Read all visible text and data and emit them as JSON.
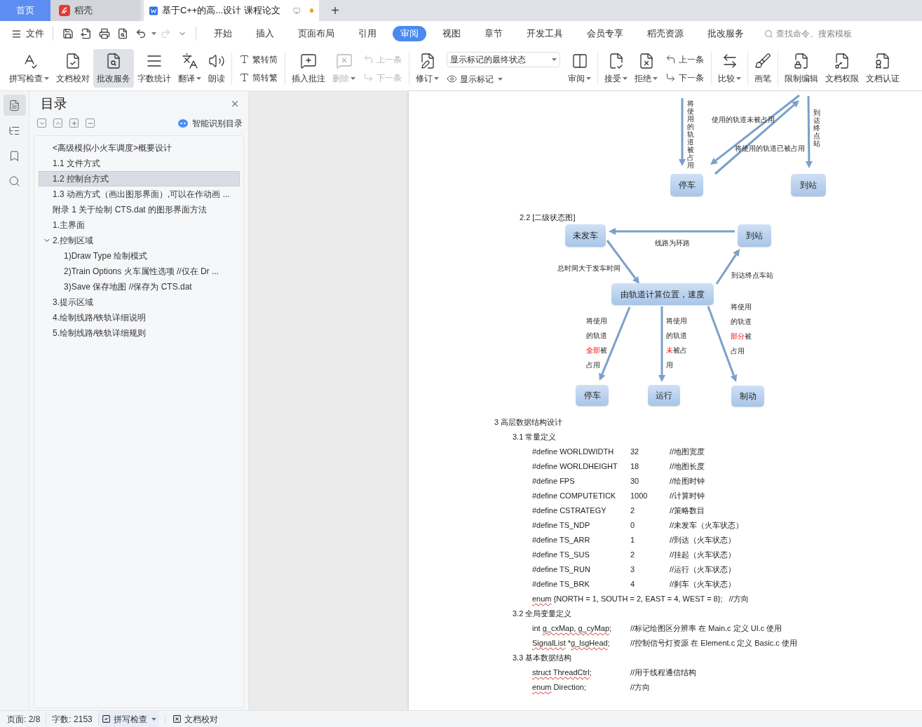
{
  "tabs": [
    {
      "kind": "home",
      "label": "首页",
      "selected": false
    },
    {
      "kind": "app",
      "label": "稻壳",
      "selected": false
    },
    {
      "kind": "doc",
      "label": "基于C++的高...设计 课程论文",
      "selected": true,
      "unsaved": true
    }
  ],
  "new_tab": "+",
  "menu": {
    "file": "文件",
    "quick_access": [
      {
        "disabled": false
      },
      {
        "disabled": false
      },
      {
        "disabled": false
      },
      {
        "disabled": false
      },
      {
        "disabled": false
      },
      {
        "disabled": true
      },
      {
        "disabled": false
      }
    ],
    "tabs": [
      {
        "label": "开始",
        "selected": false
      },
      {
        "label": "插入",
        "selected": false
      },
      {
        "label": "页面布局",
        "selected": false
      },
      {
        "label": "引用",
        "selected": false
      },
      {
        "label": "审阅",
        "selected": true
      },
      {
        "label": "视图",
        "selected": false
      },
      {
        "label": "章节",
        "selected": false
      },
      {
        "label": "开发工具",
        "selected": false
      },
      {
        "label": "会员专享",
        "selected": false
      },
      {
        "label": "稻壳资源",
        "selected": false
      },
      {
        "label": "批改服务",
        "selected": false
      }
    ],
    "search": {
      "placeholder": "查找命令、搜索模板"
    }
  },
  "toolbar": [
    {
      "kind": "button",
      "label": "拼写检查",
      "dropdown": true,
      "disabled": false,
      "selected": false
    },
    {
      "kind": "button",
      "label": "文档校对",
      "dropdown": false,
      "disabled": false,
      "selected": false
    },
    {
      "kind": "button",
      "label": "批改服务",
      "dropdown": false,
      "disabled": false,
      "selected": true
    },
    {
      "kind": "button",
      "label": "字数统计",
      "dropdown": false,
      "disabled": false,
      "selected": false
    },
    {
      "kind": "button",
      "label": "翻译",
      "dropdown": true,
      "disabled": false,
      "selected": false
    },
    {
      "kind": "button",
      "label": "朗读",
      "dropdown": false,
      "disabled": false,
      "selected": false
    },
    {
      "kind": "separator"
    },
    {
      "kind": "stack",
      "items": [
        {
          "label": "繁转简",
          "disabled": false
        },
        {
          "label": "简转繁",
          "disabled": false
        }
      ]
    },
    {
      "kind": "separator"
    },
    {
      "kind": "button",
      "label": "插入批注",
      "dropdown": false,
      "disabled": false,
      "selected": false
    },
    {
      "kind": "button",
      "label": "删除",
      "dropdown": true,
      "disabled": true,
      "selected": false
    },
    {
      "kind": "stack",
      "items": [
        {
          "label": "上一条",
          "disabled": true
        },
        {
          "label": "下一条",
          "disabled": true
        }
      ]
    },
    {
      "kind": "separator"
    },
    {
      "kind": "button",
      "label": "修订",
      "dropdown": true,
      "disabled": false,
      "selected": false
    },
    {
      "kind": "select",
      "value": "显示标记的最终状态",
      "sub": {
        "label": "显示标记",
        "dropdown": true
      }
    },
    {
      "kind": "button",
      "label": "审阅",
      "dropdown": true,
      "disabled": false,
      "selected": false
    },
    {
      "kind": "separator"
    },
    {
      "kind": "button",
      "label": "接受",
      "dropdown": true,
      "disabled": false,
      "selected": false
    },
    {
      "kind": "button",
      "label": "拒绝",
      "dropdown": true,
      "disabled": false,
      "selected": false
    },
    {
      "kind": "stack",
      "items": [
        {
          "label": "上一条",
          "disabled": false
        },
        {
          "label": "下一条",
          "disabled": false
        }
      ]
    },
    {
      "kind": "separator"
    },
    {
      "kind": "button",
      "label": "比较",
      "dropdown": true,
      "disabled": false,
      "selected": false
    },
    {
      "kind": "separator"
    },
    {
      "kind": "button",
      "label": "画笔",
      "dropdown": false,
      "disabled": false,
      "selected": false
    },
    {
      "kind": "separator"
    },
    {
      "kind": "button",
      "label": "限制编辑",
      "dropdown": false,
      "disabled": false,
      "selected": false
    },
    {
      "kind": "button",
      "label": "文档权限",
      "dropdown": false,
      "disabled": false,
      "selected": false
    },
    {
      "kind": "button",
      "label": "文档认证",
      "dropdown": false,
      "disabled": false,
      "selected": false
    }
  ],
  "sidebar": {
    "rail": [
      {
        "selected": true
      },
      {
        "selected": false
      },
      {
        "selected": false
      },
      {
        "selected": false
      }
    ],
    "title": "目录",
    "smart_button": "智能识别目录",
    "toc": [
      {
        "label": "<高级模拟小火车调度>概要设计",
        "selected": false
      },
      {
        "label": "1.1  文件方式",
        "selected": false
      },
      {
        "label": "1.2  控制台方式",
        "selected": true
      },
      {
        "label": "1.3  动画方式（画出图形界面）,可以在作动画 ...",
        "selected": false
      },
      {
        "label": "附录 1  关于绘制 CTS.dat 的图形界面方法",
        "selected": false
      },
      {
        "label": "1.主界面",
        "selected": false
      },
      {
        "label": "2.控制区域",
        "selected": false,
        "expanded": true,
        "children": [
          {
            "label": "1)Draw Type 绘制模式",
            "selected": false
          },
          {
            "label": "2)Train Options  火车属性选项   //仅在 Dr ...",
            "selected": false
          },
          {
            "label": "3)Save  保存地图   //保存为 CTS.dat",
            "selected": false
          }
        ]
      },
      {
        "label": "3.提示区域",
        "selected": false
      },
      {
        "label": "4.绘制线路/铁轨详细说明",
        "selected": false
      },
      {
        "label": "5.绘制线路/铁轨详细规则",
        "selected": false
      }
    ]
  },
  "document": {
    "diagram_top": {
      "nodes": [
        "停车",
        "到站"
      ],
      "labels": [
        {
          "kind": "vertical",
          "text": "将使用的轨道被占用"
        },
        {
          "kind": "plain",
          "text": "使用的轨道未被占用"
        },
        {
          "kind": "plain",
          "text": "将使用的轨道已被占用"
        },
        {
          "kind": "vertical",
          "text": "到达终点站"
        }
      ]
    },
    "section_heading": "2.2   [二级状态图]",
    "diagram": {
      "nodes": [
        "未发车",
        "到站",
        "由轨道计算位置，速度",
        "停车",
        "运行",
        "制动"
      ],
      "labels": [
        {
          "kind": "plain",
          "text": "线路为环路"
        },
        {
          "kind": "plain",
          "text": "总时间大于发车时间"
        },
        {
          "kind": "plain",
          "text": "到达终点车站"
        },
        {
          "kind": "wrapped",
          "parts": [
            {
              "text": "将使用的轨道"
            },
            {
              "text": "全部",
              "highlight": true
            },
            {
              "text": "被占用"
            }
          ]
        },
        {
          "kind": "wrapped",
          "parts": [
            {
              "text": "将使用的轨道"
            },
            {
              "text": "未",
              "highlight": true
            },
            {
              "text": "被占用"
            }
          ]
        },
        {
          "kind": "wrapped",
          "parts": [
            {
              "text": "将使用的轨道"
            },
            {
              "text": "部分",
              "highlight": true
            },
            {
              "text": "被占用"
            }
          ]
        }
      ]
    },
    "lines": [
      {
        "kind": "h1",
        "text": "3 高层数据结构设计"
      },
      {
        "kind": "h2",
        "text": "3.1 常量定义"
      },
      {
        "kind": "define",
        "name": "#define WORLDWIDTH",
        "value": "32",
        "comment": "//地图宽度"
      },
      {
        "kind": "define",
        "name": "#define WORLDHEIGHT",
        "value": "18",
        "comment": "//地图长度"
      },
      {
        "kind": "define",
        "name": "#define FPS",
        "value": "30",
        "comment": "//绘图时钟"
      },
      {
        "kind": "define",
        "name": "#define COMPUTETICK",
        "value": "1000",
        "comment": "//计算时钟"
      },
      {
        "kind": "define",
        "name": "#define CSTRATEGY",
        "value": "2",
        "comment": "//策略数目"
      },
      {
        "kind": "define",
        "name": "#define TS_NDP",
        "value": "0",
        "comment": "//未发车（火车状态）"
      },
      {
        "kind": "define",
        "name": "#define TS_ARR",
        "value": "1",
        "comment": "//到达（火车状态）"
      },
      {
        "kind": "define",
        "name": "#define TS_SUS",
        "value": "2",
        "comment": "//挂起（火车状态）"
      },
      {
        "kind": "define",
        "name": "#define TS_RUN",
        "value": "3",
        "comment": "//运行（火车状态）"
      },
      {
        "kind": "define",
        "name": "#define TS_BRK",
        "value": "4",
        "comment": "//刹车（火车状态）"
      },
      {
        "kind": "code",
        "parts": [
          {
            "text": "enum",
            "misspelled": true
          },
          {
            "text": " {NORTH = 1, SOUTH = 2, EAST = 4, WEST = 8};   //方向"
          }
        ]
      },
      {
        "kind": "h2",
        "text": "3.2  全局变量定义"
      },
      {
        "kind": "code",
        "parts": [
          {
            "text": "int "
          },
          {
            "text": "g_cxMap, g_cyMap",
            "misspelled": true
          },
          {
            "text": ";"
          }
        ],
        "comment": "//标记绘图区分辨率  在 Main.c 定义  UI.c 使用"
      },
      {
        "kind": "code",
        "parts": [
          {
            "text": "SignalList",
            "misspelled": true
          },
          {
            "text": " *"
          },
          {
            "text": "g_lsgHead",
            "misspelled": true
          },
          {
            "text": ";"
          }
        ],
        "comment": "//控制信号灯资源  在 Element.c 定义  Basic.c 使用"
      },
      {
        "kind": "h2",
        "text": "3.3  基本数据结构"
      },
      {
        "kind": "code",
        "parts": [
          {
            "text": "struct ThreadCtrl",
            "misspelled": true
          },
          {
            "text": ";"
          }
        ],
        "comment": "//用于线程通信结构"
      },
      {
        "kind": "code",
        "parts": [
          {
            "text": "enum",
            "misspelled": true
          },
          {
            "text": " Direction;"
          }
        ],
        "comment": "//方向"
      }
    ]
  },
  "status": {
    "page": "页面: 2/8",
    "words": "字数: 2153",
    "spell": {
      "label": "拼写检查",
      "dropdown": true
    },
    "proof": "文档校对"
  }
}
